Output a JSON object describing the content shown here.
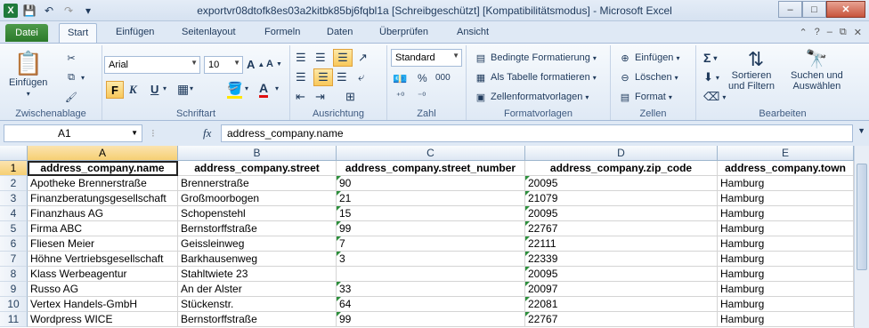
{
  "window": {
    "title": "exportvr08dtofk8es03a2kitbk85bj6fqbl1a  [Schreibgeschützt]  [Kompatibilitätsmodus]  -  Microsoft Excel",
    "logo_text": "X"
  },
  "tabs": {
    "file": "Datei",
    "items": [
      "Start",
      "Einfügen",
      "Seitenlayout",
      "Formeln",
      "Daten",
      "Überprüfen",
      "Ansicht"
    ],
    "active": "Start"
  },
  "ribbon": {
    "clipboard": {
      "label": "Zwischenablage",
      "paste": "Einfügen"
    },
    "font": {
      "label": "Schriftart",
      "name": "Arial",
      "size": "10",
      "bold": "F",
      "italic": "K",
      "underline": "U"
    },
    "alignment": {
      "label": "Ausrichtung"
    },
    "number": {
      "label": "Zahl",
      "format": "Standard",
      "percent": "%",
      "thousands": "000"
    },
    "styles": {
      "label": "Formatvorlagen",
      "conditional": "Bedingte Formatierung",
      "as_table": "Als Tabelle formatieren",
      "cell_styles": "Zellenformatvorlagen"
    },
    "cells": {
      "label": "Zellen",
      "insert": "Einfügen",
      "delete": "Löschen",
      "format": "Format"
    },
    "editing": {
      "label": "Bearbeiten",
      "sort1": "Sortieren",
      "sort2": "und Filtern",
      "find1": "Suchen und",
      "find2": "Auswählen"
    }
  },
  "formula_bar": {
    "name_box": "A1",
    "fx": "fx",
    "value": "address_company.name"
  },
  "sheet": {
    "columns": [
      "A",
      "B",
      "C",
      "D",
      "E"
    ],
    "header_row": [
      "address_company.name",
      "address_company.street",
      "address_company.street_number",
      "address_company.zip_code",
      "address_company.town"
    ],
    "rows": [
      [
        "Apotheke Brennerstraße",
        "Brennerstraße",
        "90",
        "20095",
        "Hamburg"
      ],
      [
        "Finanzberatungsgesellschaft",
        "Großmoorbogen",
        "21",
        "21079",
        "Hamburg"
      ],
      [
        "Finanzhaus AG",
        "Schopenstehl",
        "15",
        "20095",
        "Hamburg"
      ],
      [
        "Firma ABC",
        "Bernstorffstraße",
        "99",
        "22767",
        "Hamburg"
      ],
      [
        "Fliesen Meier",
        "Geissleinweg",
        "7",
        "22111",
        "Hamburg"
      ],
      [
        "Höhne Vertriebsgesellschaft",
        "Barkhausenweg",
        "3",
        "22339",
        "Hamburg"
      ],
      [
        "Klass Werbeagentur",
        "Stahltwiete 23",
        "",
        "20095",
        "Hamburg"
      ],
      [
        "Russo AG",
        "An der Alster",
        "33",
        "20097",
        "Hamburg"
      ],
      [
        "Vertex Handels-GmbH",
        "Stückenstr.",
        "64",
        "22081",
        "Hamburg"
      ],
      [
        "Wordpress WICE",
        "Bernstorffstraße",
        "99",
        "22767",
        "Hamburg"
      ]
    ],
    "row_numbers": [
      "1",
      "2",
      "3",
      "4",
      "5",
      "6",
      "7",
      "8",
      "9",
      "10",
      "11"
    ]
  }
}
